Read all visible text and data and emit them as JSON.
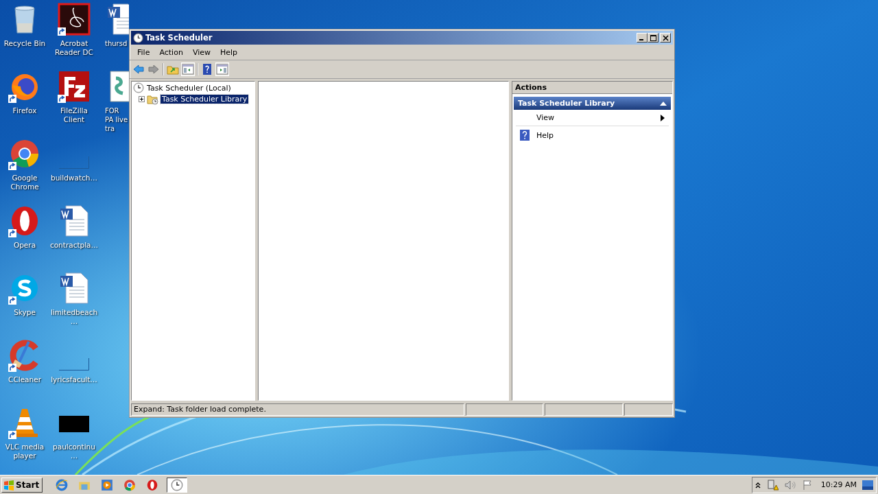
{
  "desktop_icons": [
    {
      "label": "Recycle Bin",
      "kind": "recycle",
      "shortcut": false
    },
    {
      "label": "Firefox",
      "kind": "firefox",
      "shortcut": true
    },
    {
      "label": "Google Chrome",
      "kind": "chrome",
      "shortcut": true
    },
    {
      "label": "Opera",
      "kind": "opera",
      "shortcut": true
    },
    {
      "label": "Skype",
      "kind": "skype",
      "shortcut": true
    },
    {
      "label": "CCleaner",
      "kind": "ccleaner",
      "shortcut": true
    },
    {
      "label": "VLC media player",
      "kind": "vlc",
      "shortcut": true
    },
    {
      "label": "Acrobat Reader DC",
      "kind": "acrobat",
      "shortcut": true
    },
    {
      "label": "FileZilla Client",
      "kind": "filezilla",
      "shortcut": true
    },
    {
      "label": "buildwatch…",
      "kind": "blank",
      "shortcut": false
    },
    {
      "label": "contractpla…",
      "kind": "word",
      "shortcut": false
    },
    {
      "label": "limitedbeach…",
      "kind": "word",
      "shortcut": false
    },
    {
      "label": "lyricsfacult…",
      "kind": "blank",
      "shortcut": false
    },
    {
      "label": "paulcontinu…",
      "kind": "black",
      "shortcut": false
    },
    {
      "label": "thursd",
      "kind": "word",
      "shortcut": false
    },
    {
      "label": "FOR PA live tra",
      "kind": "doc",
      "shortcut": false
    }
  ],
  "window": {
    "title": "Task Scheduler",
    "menu": [
      "File",
      "Action",
      "View",
      "Help"
    ],
    "tree": [
      {
        "label": "Task Scheduler (Local)",
        "selected": false,
        "children": [
          {
            "label": "Task Scheduler Library",
            "selected": true,
            "expanded": false
          }
        ]
      }
    ],
    "actions": {
      "header": "Actions",
      "section": {
        "title": "Task Scheduler Library",
        "expanded": true
      },
      "items": [
        {
          "label": "View",
          "kind": "submenu"
        },
        {
          "label": "Help",
          "kind": "help"
        }
      ]
    },
    "status_bar": [
      "Expand:  Task folder load complete."
    ]
  },
  "taskbar": {
    "start": "Start",
    "apps": [
      {
        "kind": "ie",
        "selected": false
      },
      {
        "kind": "explorer",
        "selected": false
      },
      {
        "kind": "media",
        "selected": false
      },
      {
        "kind": "chrome",
        "selected": false
      },
      {
        "kind": "opera",
        "selected": false
      },
      {
        "kind": "clock",
        "selected": true
      }
    ],
    "time": "10:29 AM"
  }
}
